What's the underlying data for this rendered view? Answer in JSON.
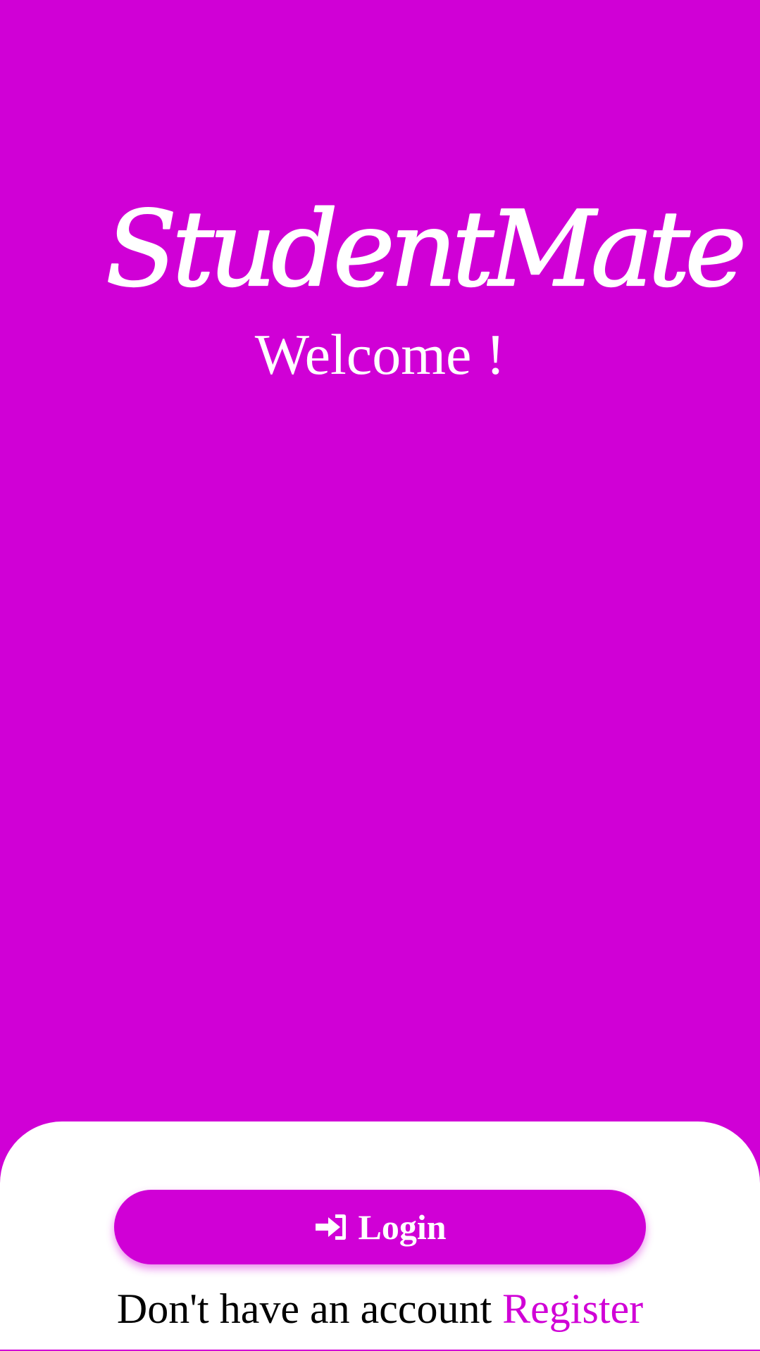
{
  "brand": {
    "logo_text": "StudentMate",
    "logo_color": "#ffffff"
  },
  "hero": {
    "welcome": "Welcome !",
    "background_color": "#d000d6"
  },
  "auth": {
    "login_icon": "sign-in-icon",
    "login_label": "Login",
    "prompt": "Don't have an account",
    "register_label": "Register",
    "accent_color": "#d000d6"
  }
}
